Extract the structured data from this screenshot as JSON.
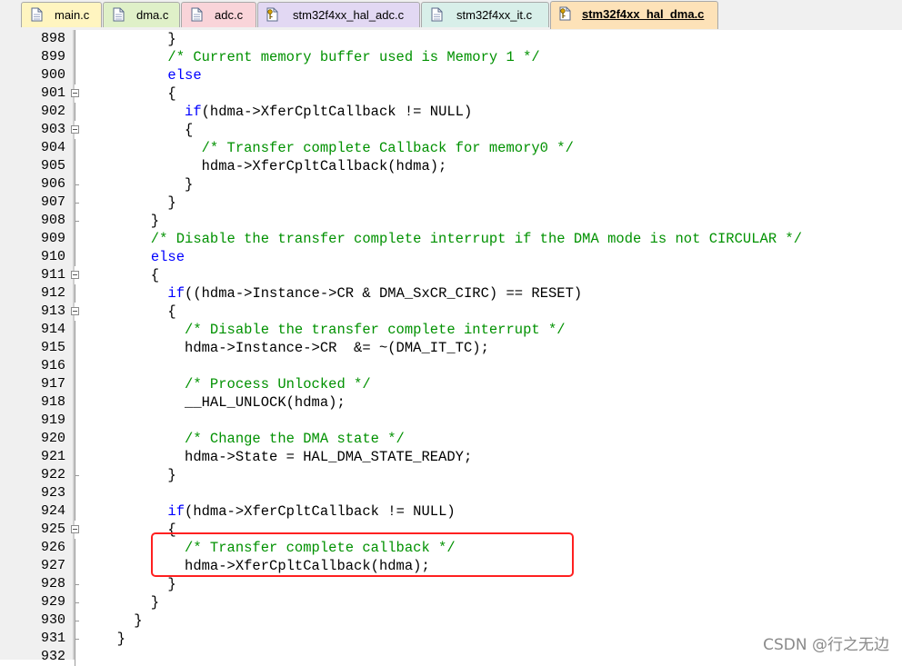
{
  "tabs": [
    {
      "label": "main.c",
      "icon": "file-icon",
      "color": "#fff5c0",
      "active": false
    },
    {
      "label": "dma.c",
      "icon": "file-icon",
      "color": "#dff0c8",
      "active": false
    },
    {
      "label": "adc.c",
      "icon": "file-icon",
      "color": "#f9d4d9",
      "active": false
    },
    {
      "label": "stm32f4xx_hal_adc.c",
      "icon": "file-key-icon",
      "color": "#e2d8f3",
      "active": false
    },
    {
      "label": "stm32f4xx_it.c",
      "icon": "file-icon",
      "color": "#d8efe9",
      "active": false
    },
    {
      "label": "stm32f4xx_hal_dma.c",
      "icon": "file-key-icon",
      "color": "#fde2b8",
      "active": true
    }
  ],
  "editor": {
    "lines": [
      {
        "num": "898",
        "fold": "line",
        "tokens": [
          {
            "t": "        }",
            "c": "plain"
          }
        ]
      },
      {
        "num": "899",
        "fold": "line",
        "tokens": [
          {
            "t": "        /* Current memory buffer used is Memory 1 */",
            "c": "comment"
          }
        ]
      },
      {
        "num": "900",
        "fold": "line",
        "tokens": [
          {
            "t": "        ",
            "c": "plain"
          },
          {
            "t": "else",
            "c": "keyword"
          }
        ]
      },
      {
        "num": "901",
        "fold": "box",
        "tokens": [
          {
            "t": "        {",
            "c": "plain"
          }
        ]
      },
      {
        "num": "902",
        "fold": "line",
        "tokens": [
          {
            "t": "          ",
            "c": "plain"
          },
          {
            "t": "if",
            "c": "keyword"
          },
          {
            "t": "(hdma->XferCpltCallback != NULL)",
            "c": "plain"
          }
        ]
      },
      {
        "num": "903",
        "fold": "box",
        "tokens": [
          {
            "t": "          {",
            "c": "plain"
          }
        ]
      },
      {
        "num": "904",
        "fold": "line",
        "tokens": [
          {
            "t": "            /* Transfer complete Callback for memory0 */",
            "c": "comment"
          }
        ]
      },
      {
        "num": "905",
        "fold": "line",
        "tokens": [
          {
            "t": "            hdma->XferCpltCallback(hdma);",
            "c": "plain"
          }
        ]
      },
      {
        "num": "906",
        "fold": "tick",
        "tokens": [
          {
            "t": "          }",
            "c": "plain"
          }
        ]
      },
      {
        "num": "907",
        "fold": "tick",
        "tokens": [
          {
            "t": "        }",
            "c": "plain"
          }
        ]
      },
      {
        "num": "908",
        "fold": "tick",
        "tokens": [
          {
            "t": "      }",
            "c": "plain"
          }
        ]
      },
      {
        "num": "909",
        "fold": "line",
        "tokens": [
          {
            "t": "      /* Disable the transfer complete interrupt if the DMA mode is not CIRCULAR */",
            "c": "comment"
          }
        ]
      },
      {
        "num": "910",
        "fold": "line",
        "tokens": [
          {
            "t": "      ",
            "c": "plain"
          },
          {
            "t": "else",
            "c": "keyword"
          }
        ]
      },
      {
        "num": "911",
        "fold": "box",
        "tokens": [
          {
            "t": "      {",
            "c": "plain"
          }
        ]
      },
      {
        "num": "912",
        "fold": "line",
        "tokens": [
          {
            "t": "        ",
            "c": "plain"
          },
          {
            "t": "if",
            "c": "keyword"
          },
          {
            "t": "((hdma->Instance->CR & DMA_SxCR_CIRC) == RESET)",
            "c": "plain"
          }
        ]
      },
      {
        "num": "913",
        "fold": "box",
        "tokens": [
          {
            "t": "        {",
            "c": "plain"
          }
        ]
      },
      {
        "num": "914",
        "fold": "line",
        "tokens": [
          {
            "t": "          /* Disable the transfer complete interrupt */",
            "c": "comment"
          }
        ]
      },
      {
        "num": "915",
        "fold": "line",
        "tokens": [
          {
            "t": "          hdma->Instance->CR  &= ~(DMA_IT_TC);",
            "c": "plain"
          }
        ]
      },
      {
        "num": "916",
        "fold": "line",
        "tokens": [
          {
            "t": "",
            "c": "plain"
          }
        ]
      },
      {
        "num": "917",
        "fold": "line",
        "tokens": [
          {
            "t": "          /* Process Unlocked */",
            "c": "comment"
          }
        ]
      },
      {
        "num": "918",
        "fold": "line",
        "tokens": [
          {
            "t": "          __HAL_UNLOCK(hdma);",
            "c": "plain"
          }
        ]
      },
      {
        "num": "919",
        "fold": "line",
        "tokens": [
          {
            "t": "",
            "c": "plain"
          }
        ]
      },
      {
        "num": "920",
        "fold": "line",
        "tokens": [
          {
            "t": "          /* Change the DMA state */",
            "c": "comment"
          }
        ]
      },
      {
        "num": "921",
        "fold": "line",
        "tokens": [
          {
            "t": "          hdma->State = HAL_DMA_STATE_READY;",
            "c": "plain"
          }
        ]
      },
      {
        "num": "922",
        "fold": "tick",
        "tokens": [
          {
            "t": "        }",
            "c": "plain"
          }
        ]
      },
      {
        "num": "923",
        "fold": "line",
        "tokens": [
          {
            "t": "",
            "c": "plain"
          }
        ]
      },
      {
        "num": "924",
        "fold": "line",
        "tokens": [
          {
            "t": "        ",
            "c": "plain"
          },
          {
            "t": "if",
            "c": "keyword"
          },
          {
            "t": "(hdma->XferCpltCallback != NULL)",
            "c": "plain"
          }
        ]
      },
      {
        "num": "925",
        "fold": "box",
        "tokens": [
          {
            "t": "        {",
            "c": "plain"
          }
        ]
      },
      {
        "num": "926",
        "fold": "line",
        "tokens": [
          {
            "t": "          /* Transfer complete callback */",
            "c": "comment"
          }
        ]
      },
      {
        "num": "927",
        "fold": "line",
        "tokens": [
          {
            "t": "          hdma->XferCpltCallback(hdma);",
            "c": "plain"
          }
        ]
      },
      {
        "num": "928",
        "fold": "tick",
        "tokens": [
          {
            "t": "        }",
            "c": "plain"
          }
        ]
      },
      {
        "num": "929",
        "fold": "tick",
        "tokens": [
          {
            "t": "      }",
            "c": "plain"
          }
        ]
      },
      {
        "num": "930",
        "fold": "tick",
        "tokens": [
          {
            "t": "    }",
            "c": "plain"
          }
        ]
      },
      {
        "num": "931",
        "fold": "tick",
        "tokens": [
          {
            "t": "  }",
            "c": "plain"
          }
        ]
      },
      {
        "num": "932",
        "fold": "line",
        "tokens": [
          {
            "t": "",
            "c": "plain"
          }
        ]
      }
    ]
  },
  "colors": {
    "comment": "#009100",
    "keyword": "#0000ff",
    "highlight": "#ff2020"
  },
  "watermark": "CSDN @行之无边"
}
